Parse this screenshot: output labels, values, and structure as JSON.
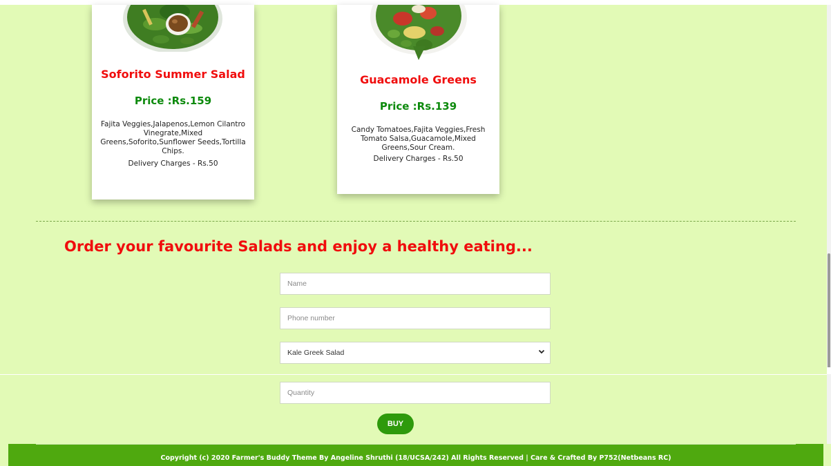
{
  "cards": [
    {
      "title": "Soforito Summer Salad",
      "price": "Price :Rs.159",
      "description": "Fajita Veggies,Jalapenos,Lemon Cilantro Vinegrate,Mixed Greens,Soforito,Sunflower Seeds,Tortilla Chips.",
      "delivery": "Delivery Charges - Rs.50"
    },
    {
      "title": "Guacamole Greens",
      "price": "Price :Rs.139",
      "description": "Candy Tomatoes,Fajita Veggies,Fresh Tomato Salsa,Guacamole,Mixed Greens,Sour Cream.",
      "delivery": "Delivery Charges - Rs.50"
    }
  ],
  "order": {
    "heading": "Order your favourite Salads and enjoy a healthy eating...",
    "name_placeholder": "Name",
    "phone_placeholder": "Phone number",
    "salad_selected": "Kale Greek Salad",
    "quantity_placeholder": "Quantity",
    "buy_label": "BUY"
  },
  "footer": {
    "text": "Copyright (c) 2020 Farmer's Buddy Theme By Angeline Shruthi (18/UCSA/242) All Rights Reserved | Care & Crafted By P752(Netbeans RC)"
  },
  "colors": {
    "page_bg": "#e2fab6",
    "title_red": "#f00d0d",
    "price_green": "#0d8a0d",
    "button_green": "#2e9a0c",
    "footer_green": "#4fa90f"
  },
  "icons": [
    "salad-bowl-image",
    "chevron-down-icon"
  ]
}
